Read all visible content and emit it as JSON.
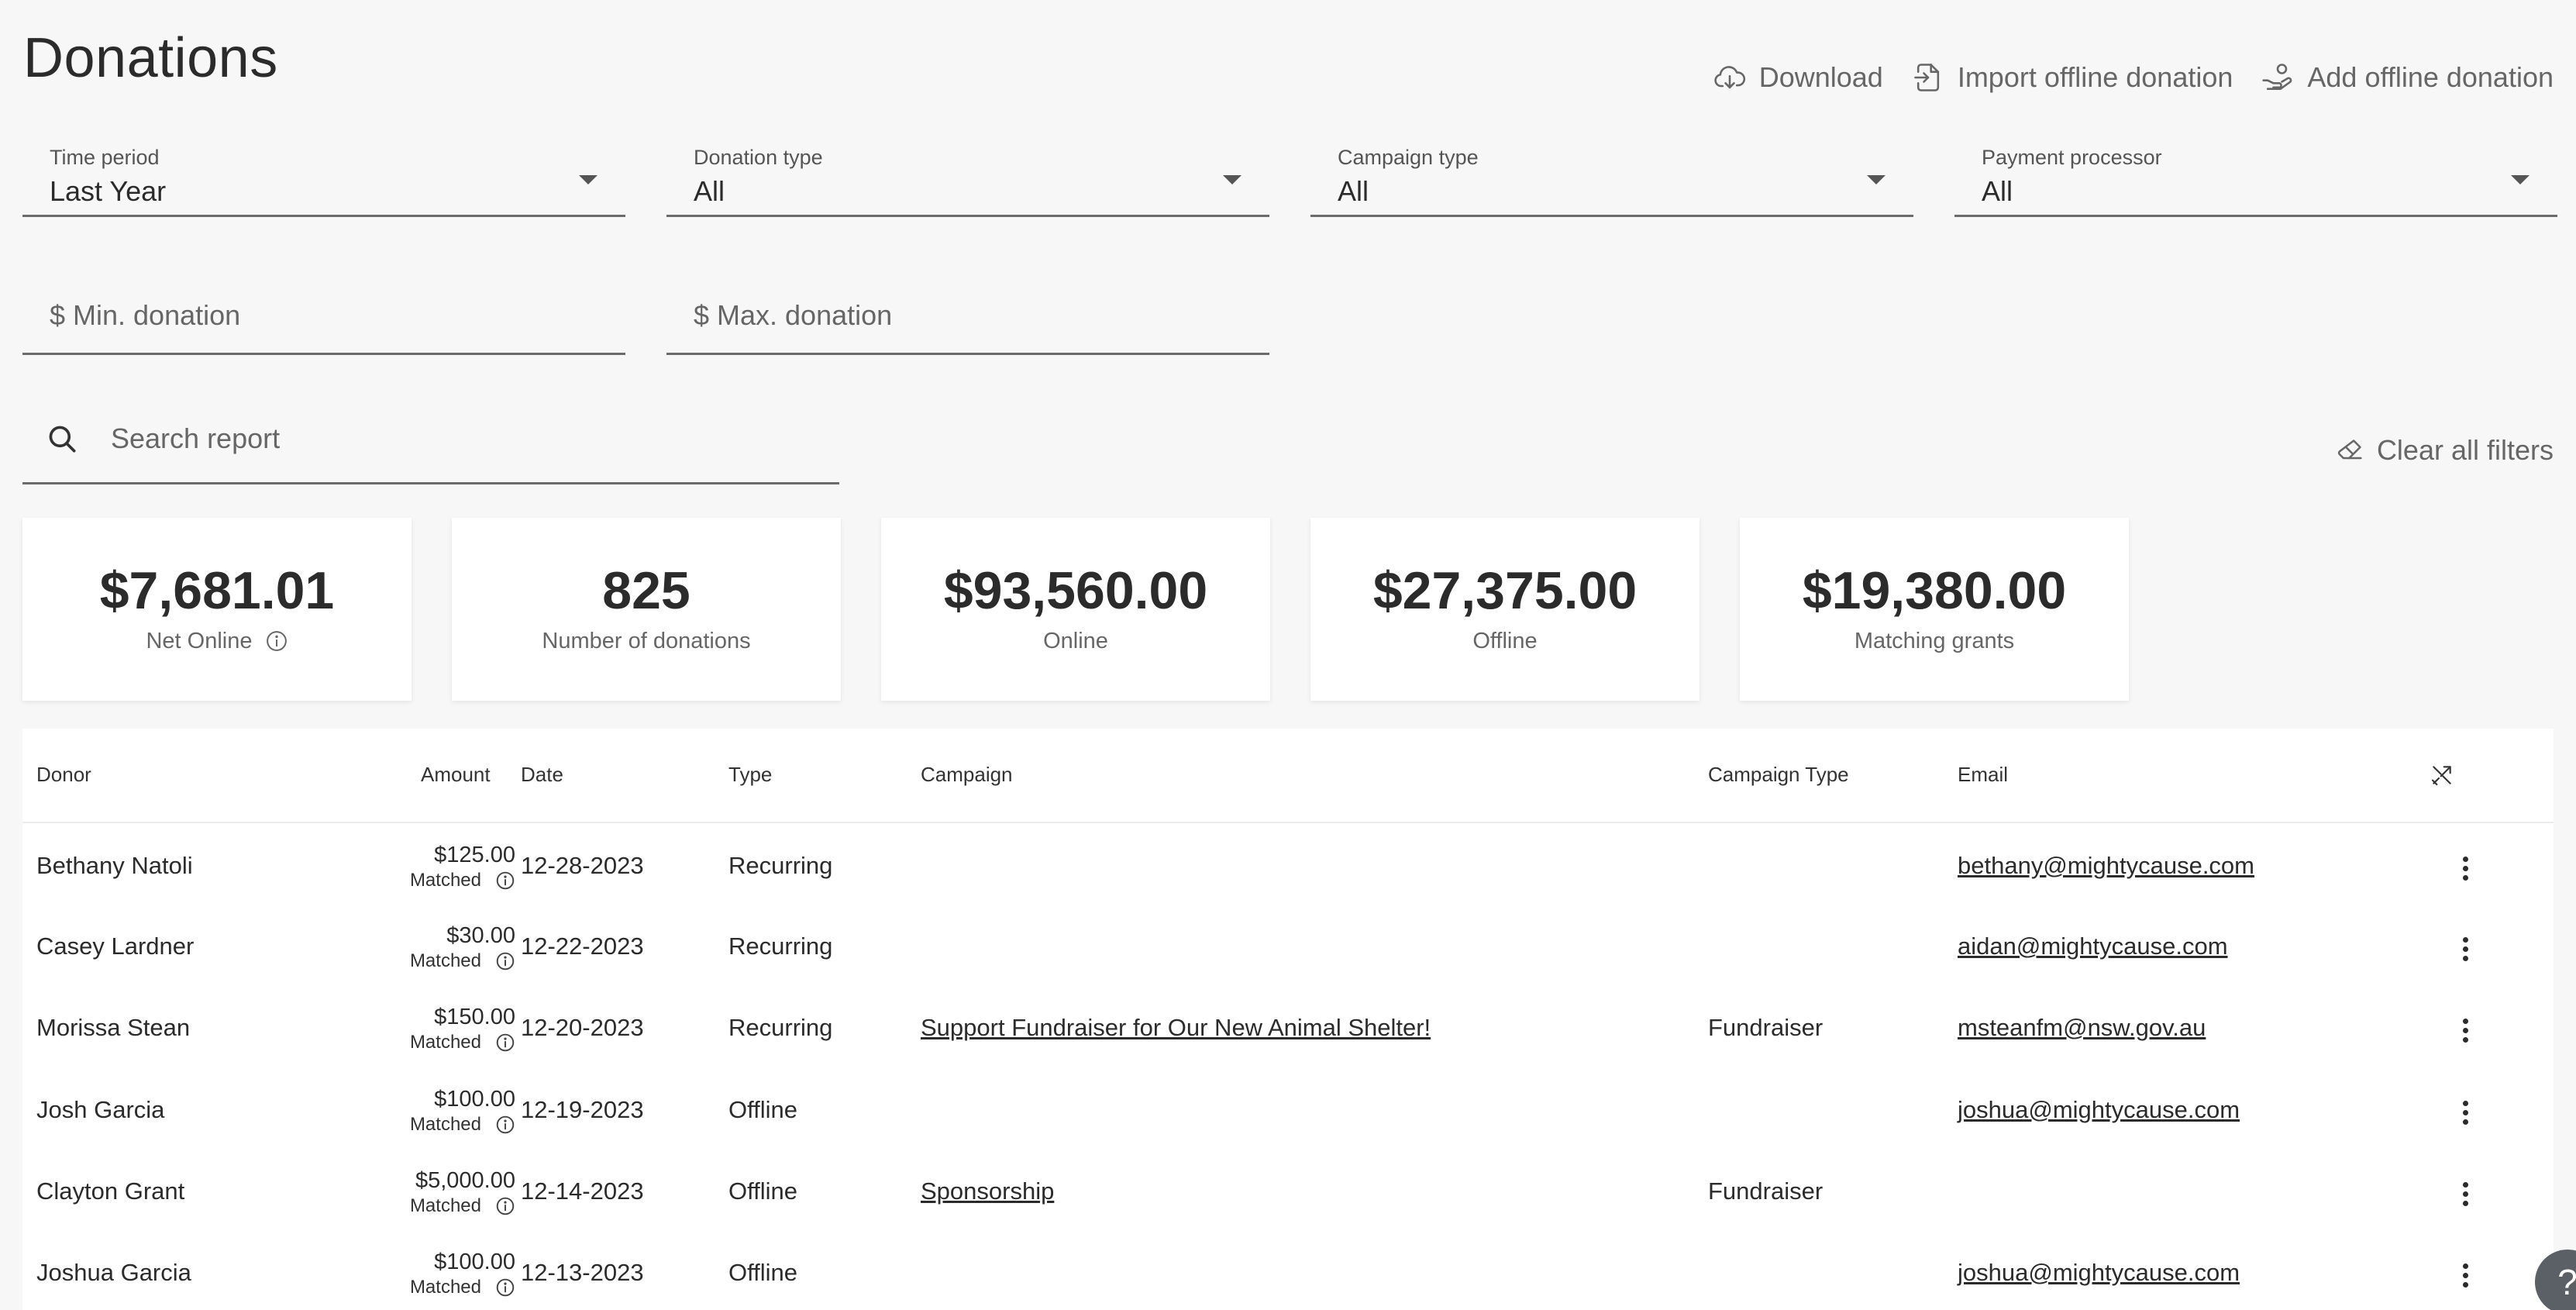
{
  "header": {
    "title": "Donations",
    "actions": [
      {
        "label": "Download",
        "icon": "cloud-download-icon"
      },
      {
        "label": "Import offline donation",
        "icon": "file-import-icon"
      },
      {
        "label": "Add offline donation",
        "icon": "hand-coin-icon"
      }
    ]
  },
  "filters": {
    "time_period": {
      "label": "Time period",
      "value": "Last Year"
    },
    "donation_type": {
      "label": "Donation type",
      "value": "All"
    },
    "campaign_type": {
      "label": "Campaign type",
      "value": "All"
    },
    "payment_processor": {
      "label": "Payment processor",
      "value": "All"
    },
    "min_donation": {
      "placeholder": "$ Min. donation"
    },
    "max_donation": {
      "placeholder": "$ Max. donation"
    },
    "search": {
      "placeholder": "Search report"
    },
    "clear_all": "Clear all filters"
  },
  "stats": [
    {
      "value": "$7,681.01",
      "label": "Net Online",
      "has_info": true
    },
    {
      "value": "825",
      "label": "Number of donations",
      "has_info": false
    },
    {
      "value": "$93,560.00",
      "label": "Online",
      "has_info": false
    },
    {
      "value": "$27,375.00",
      "label": "Offline",
      "has_info": false
    },
    {
      "value": "$19,380.00",
      "label": "Matching grants",
      "has_info": false
    }
  ],
  "table": {
    "columns": {
      "donor": "Donor",
      "amount": "Amount",
      "date": "Date",
      "type": "Type",
      "campaign": "Campaign",
      "campaign_type": "Campaign Type",
      "email": "Email"
    },
    "matched_label": "Matched",
    "rows": [
      {
        "donor": "Bethany Natoli",
        "amount": "$125.00",
        "date": "12-28-2023",
        "type": "Recurring",
        "campaign": "",
        "campaign_type": "",
        "email": "bethany@mightycause.com"
      },
      {
        "donor": "Casey Lardner",
        "amount": "$30.00",
        "date": "12-22-2023",
        "type": "Recurring",
        "campaign": "",
        "campaign_type": "",
        "email": "aidan@mightycause.com"
      },
      {
        "donor": "Morissa Stean",
        "amount": "$150.00",
        "date": "12-20-2023",
        "type": "Recurring",
        "campaign": "Support Fundraiser for Our New Animal Shelter!",
        "campaign_type": "Fundraiser",
        "email": "msteanfm@nsw.gov.au"
      },
      {
        "donor": "Josh Garcia",
        "amount": "$100.00",
        "date": "12-19-2023",
        "type": "Offline",
        "campaign": "",
        "campaign_type": "",
        "email": "joshua@mightycause.com"
      },
      {
        "donor": "Clayton Grant",
        "amount": "$5,000.00",
        "date": "12-14-2023",
        "type": "Offline",
        "campaign": "Sponsorship",
        "campaign_type": "Fundraiser",
        "email": ""
      },
      {
        "donor": "Joshua Garcia",
        "amount": "$100.00",
        "date": "12-13-2023",
        "type": "Offline",
        "campaign": "",
        "campaign_type": "",
        "email": "joshua@mightycause.com"
      }
    ]
  },
  "help": {
    "label": "?"
  }
}
